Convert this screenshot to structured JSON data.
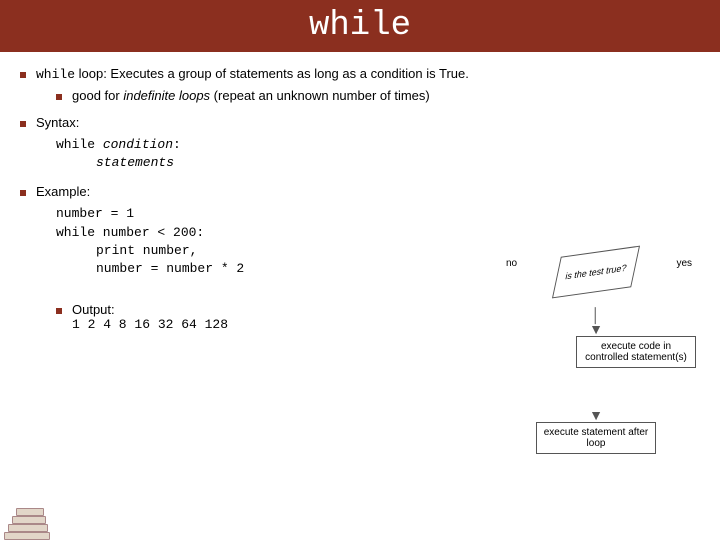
{
  "title": "while",
  "bullets": {
    "loop_def_prefix": "while",
    "loop_def_rest": " loop: Executes a group of statements as long as a condition is True.",
    "good_for": "good for ",
    "good_for_italic": "indefinite loops",
    "good_for_rest": " (repeat an unknown number of times)",
    "syntax_label": "Syntax:",
    "syntax_line1a": "while ",
    "syntax_line1b": "condition",
    "syntax_line1c": ":",
    "syntax_line2": "statements",
    "example_label": "Example:",
    "code": {
      "l1": "number = 1",
      "l2": "while number < 200:",
      "l3": "print number,",
      "l4": "number = number * 2"
    },
    "output_label": "Output:",
    "output_value": "1 2 4 8 16 32 64 128"
  },
  "diagram": {
    "no": "no",
    "yes": "yes",
    "test": "is the test true?",
    "box1": "execute code in controlled statement(s)",
    "box2": "execute statement after loop"
  }
}
